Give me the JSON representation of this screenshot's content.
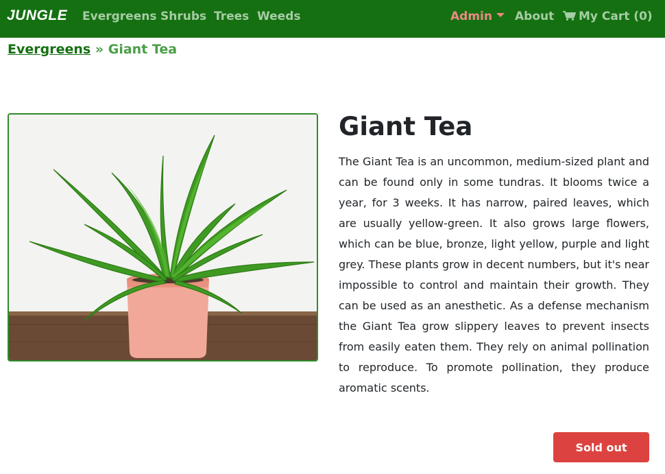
{
  "navbar": {
    "brand": "JUNGLE",
    "links": [
      "Evergreens",
      "Shrubs",
      "Trees",
      "Weeds"
    ],
    "admin": "Admin",
    "about": "About",
    "cart": "My Cart (0)",
    "background": "#157012",
    "link_color": "#a6cda4",
    "admin_color": "#ec8a83"
  },
  "breadcrumb": {
    "parent": "Evergreens",
    "separator": "»",
    "current": "Giant Tea"
  },
  "product": {
    "name": "Giant Tea",
    "description": "The Giant Tea is an uncommon, medium-sized plant and can be found only in some tundras. It blooms twice a year, for 3 weeks. It has narrow, paired leaves, which are usually yellow-green. It also grows large flowers, which can be blue, bronze, light yellow, purple and light grey. These plants grow in decent numbers, but it's near impossible to control and maintain their growth. They can be used as an anesthetic. As a defense mechanism the Giant Tea grow slippery leaves to prevent insects from easily eaten them. They rely on animal pollination to reproduce. To promote pollination, they produce aromatic scents.",
    "status_button": "Sold out",
    "status_color": "#dc4340"
  },
  "icons": {
    "cart": "shopping-cart-icon",
    "admin_dropdown": "caret-down-icon"
  }
}
